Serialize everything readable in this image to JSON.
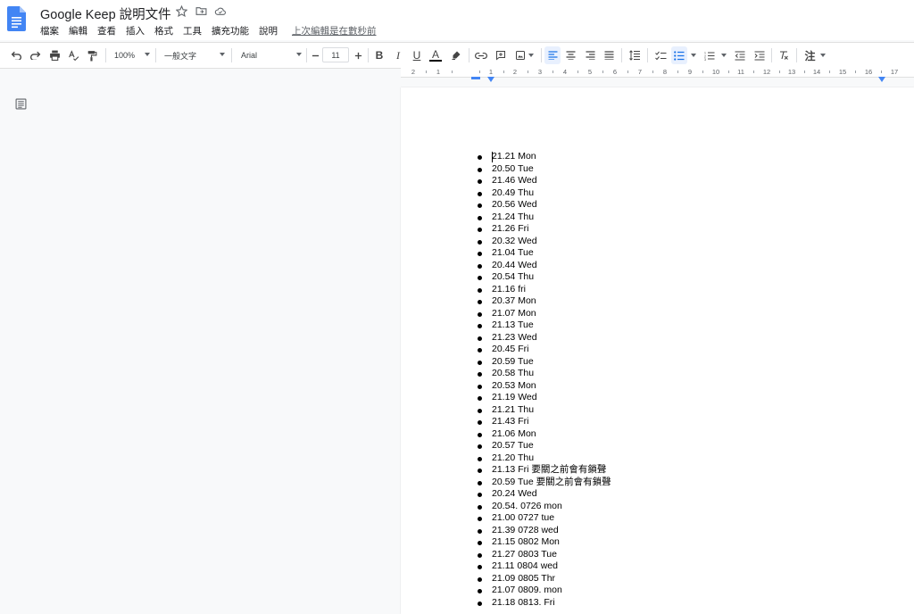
{
  "app": {
    "title": "Google Keep 說明文件"
  },
  "menu": {
    "items": [
      "檔案",
      "編輯",
      "查看",
      "插入",
      "格式",
      "工具",
      "擴充功能",
      "說明"
    ],
    "last_edit": "上次編輯是在數秒前"
  },
  "toolbar": {
    "zoom": "100%",
    "style": "一般文字",
    "font": "Arial",
    "font_size": "11",
    "bold": "B",
    "italic": "I",
    "underline": "U",
    "text_color": "A",
    "input_tools": "注"
  },
  "ruler": {
    "numbers": [
      "2",
      "1",
      "1",
      "2",
      "3",
      "4",
      "5",
      "6",
      "7",
      "8",
      "9",
      "10",
      "11",
      "12",
      "13",
      "14",
      "15",
      "16",
      "17"
    ]
  },
  "document": {
    "items": [
      "21.21 Mon",
      "20.50 Tue",
      "21.46 Wed",
      "20.49 Thu",
      "20.56 Wed",
      "21.24 Thu",
      "21.26 Fri",
      "20.32 Wed",
      "21.04 Tue",
      "20.44 Wed",
      "20.54 Thu",
      "21.16 fri",
      "20.37 Mon",
      "21.07 Mon",
      "21.13 Tue",
      "21.23 Wed",
      "20.45 Fri",
      "20.59 Tue",
      "20.58 Thu",
      "20.53 Mon",
      "21.19 Wed",
      "21.21 Thu",
      "21.43 Fri",
      "21.06 Mon",
      "20.57 Tue",
      "21.20 Thu",
      "21.13 Fri 要關之前會有鎖聲",
      "20.59 Tue 要關之前會有鎖聲",
      "20.24 Wed",
      "20.54. 0726 mon",
      "21.00 0727 tue",
      "21.39 0728 wed",
      "21.15 0802 Mon",
      "21.27 0803 Tue",
      "21.11 0804 wed",
      "21.09 0805 Thr",
      "21.07 0809. mon",
      "21.18 0813. Fri"
    ]
  },
  "colors": {
    "docs_blue": "#4285f4",
    "accent_blue": "#1a73e8"
  }
}
